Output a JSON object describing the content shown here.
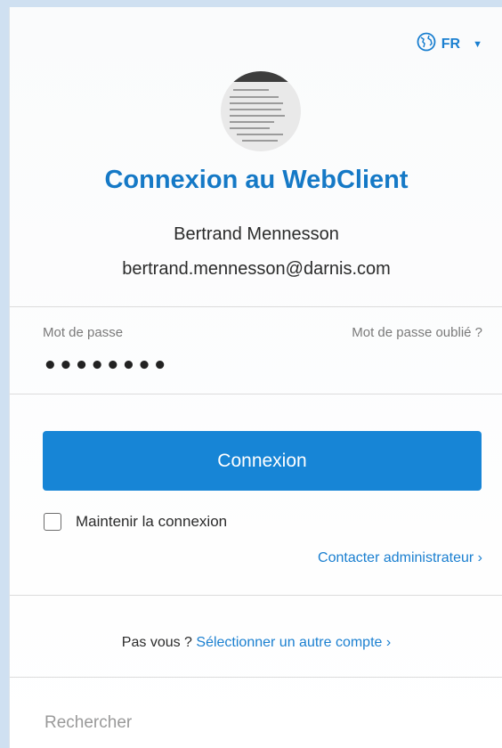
{
  "header": {
    "language": {
      "icon": "globe-icon",
      "code": "FR",
      "caret": "▼"
    }
  },
  "account": {
    "title": "Connexion au WebClient",
    "name": "Bertrand Mennesson",
    "email": "bertrand.mennesson@darnis.com"
  },
  "password": {
    "label": "Mot de passe",
    "forgot_link": "Mot de passe oublié ?",
    "value": "••••••••"
  },
  "actions": {
    "connect_label": "Connexion",
    "keep_signed_in_label": "Maintenir la connexion",
    "keep_signed_in_checked": false,
    "contact_admin_link": "Contacter administrateur ›"
  },
  "switch_account": {
    "prompt": "Pas vous ?",
    "link": "Sélectionner un autre compte ›"
  },
  "search": {
    "placeholder": "Rechercher"
  },
  "colors": {
    "accent": "#1785d6",
    "link": "#1a7fd0",
    "title": "#1579c6",
    "background": "#cfe0f1"
  }
}
